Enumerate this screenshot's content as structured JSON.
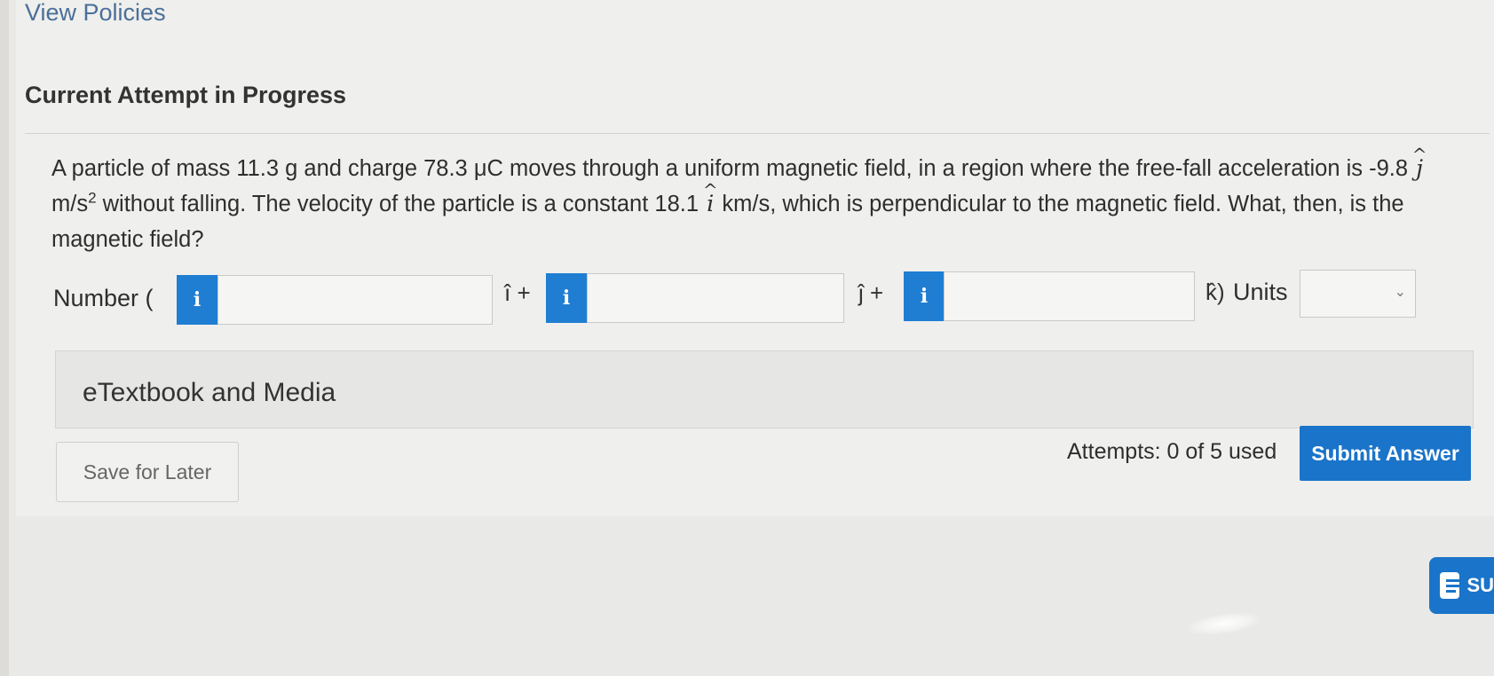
{
  "header": {
    "view_policies": "View Policies",
    "attempt_title": "Current Attempt in Progress"
  },
  "question": {
    "part1": "A particle of mass 11.3 g and charge 78.3 μC moves through a uniform magnetic field, in a region where the free-fall acceleration is -9.8 ",
    "j_symbol": "j",
    "part2": " m/s",
    "exp": "2",
    "part3": " without falling. The velocity of the particle is a constant 18.1 ",
    "i_symbol": "i",
    "part4": " km/s, which is perpendicular to the magnetic field. What, then, is the magnetic field?"
  },
  "answer": {
    "number_label": "Number (",
    "info_icon": "i",
    "i_unit": "î +",
    "j_unit": "ĵ +",
    "k_unit": "k̂)",
    "units_label": "Units",
    "input_i_value": "",
    "input_j_value": "",
    "input_k_value": "",
    "units_selected": ""
  },
  "etextbook": {
    "label": "eTextbook and Media"
  },
  "footer": {
    "save_label": "Save for Later",
    "attempts_text": "Attempts: 0 of 5 used",
    "submit_label": "Submit Answer"
  },
  "support": {
    "label": "SU"
  },
  "colors": {
    "accent_blue": "#1f7ed2",
    "submit_blue": "#1a74c9",
    "link_blue": "#4a6f9a"
  },
  "icons": [
    "info-icon",
    "chevron-down-icon",
    "chat-icon"
  ]
}
